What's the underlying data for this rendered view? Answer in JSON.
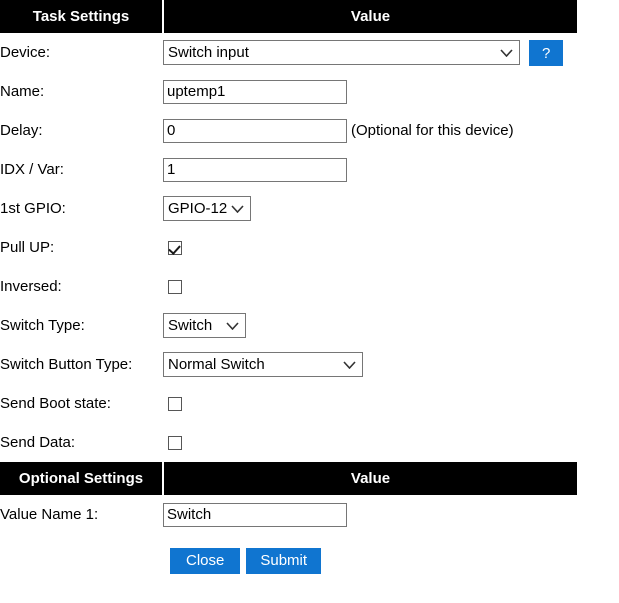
{
  "table": {
    "headers": {
      "task_settings": "Task Settings",
      "optional_settings": "Optional Settings",
      "value": "Value"
    }
  },
  "task_settings": {
    "device": {
      "label": "Device:",
      "selected": "Switch input",
      "help_label": "?"
    },
    "name": {
      "label": "Name:",
      "value": "uptemp1"
    },
    "delay": {
      "label": "Delay:",
      "value": "0",
      "hint": "(Optional for this device)"
    },
    "idx_var": {
      "label": "IDX / Var:",
      "value": "1"
    },
    "gpio1": {
      "label": "1st GPIO:",
      "selected": "GPIO-12"
    },
    "pull_up": {
      "label": "Pull UP:",
      "checked": true
    },
    "inversed": {
      "label": "Inversed:",
      "checked": false
    },
    "switch_type": {
      "label": "Switch Type:",
      "selected": "Switch"
    },
    "switch_button_type": {
      "label": "Switch Button Type:",
      "selected": "Normal Switch"
    },
    "send_boot_state": {
      "label": "Send Boot state:",
      "checked": false
    },
    "send_data": {
      "label": "Send Data:",
      "checked": false
    }
  },
  "optional_settings": {
    "value_name_1": {
      "label": "Value Name 1:",
      "value": "Switch"
    }
  },
  "actions": {
    "close": "Close",
    "submit": "Submit"
  },
  "colors": {
    "header_bg": "#000000",
    "header_fg": "#ffffff",
    "accent_blue": "#1075d0",
    "page_bg": "#ffffff",
    "field_border": "#767676"
  }
}
